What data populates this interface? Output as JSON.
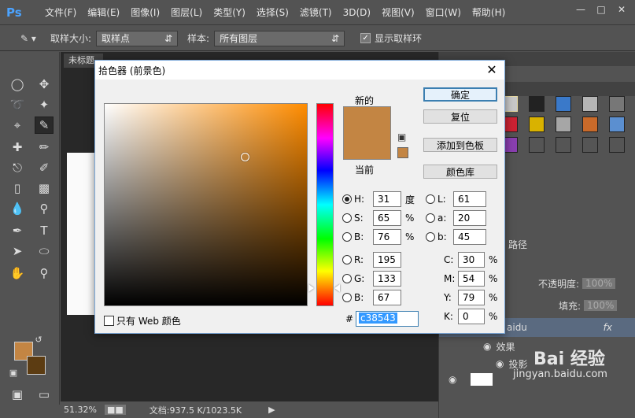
{
  "app": {
    "logo": "Ps",
    "menu": [
      "文件(F)",
      "编辑(E)",
      "图像(I)",
      "图层(L)",
      "类型(Y)",
      "选择(S)",
      "滤镜(T)",
      "3D(D)",
      "视图(V)",
      "窗口(W)",
      "帮助(H)"
    ]
  },
  "options": {
    "sample_size_label": "取样大小:",
    "sample_size_value": "取样点",
    "sample_label": "样本:",
    "sample_value": "所有图层",
    "show_ring_label": "显示取样环"
  },
  "document": {
    "tab_label": "未标题",
    "zoom": "51.32%",
    "doc_info": "文档:937.5 K/1023.5K"
  },
  "layers_panel": {
    "paths_tab": "路径",
    "opacity_label": "不透明度:",
    "opacity_value": "100%",
    "fill_label": "填充:",
    "fill_value": "100%",
    "layer_name": "aidu",
    "fx_label": "fx",
    "effects_label": "效果",
    "shadow_label": "投影"
  },
  "dialog": {
    "title": "拾色器 (前景色)",
    "new_label": "新的",
    "current_label": "当前",
    "buttons": {
      "ok": "确定",
      "reset": "复位",
      "add_swatch": "添加到色板",
      "color_library": "颜色库"
    },
    "web_only_label": "只有 Web 颜色",
    "hsb": [
      {
        "label": "H:",
        "value": "31",
        "unit": "度",
        "selected": true
      },
      {
        "label": "S:",
        "value": "65",
        "unit": "%",
        "selected": false
      },
      {
        "label": "B:",
        "value": "76",
        "unit": "%",
        "selected": false
      }
    ],
    "rgb": [
      {
        "label": "R:",
        "value": "195"
      },
      {
        "label": "G:",
        "value": "133"
      },
      {
        "label": "B:",
        "value": "67"
      }
    ],
    "lab": [
      {
        "label": "L:",
        "value": "61"
      },
      {
        "label": "a:",
        "value": "20"
      },
      {
        "label": "b:",
        "value": "45"
      }
    ],
    "cmyk": [
      {
        "label": "C:",
        "value": "30",
        "unit": "%"
      },
      {
        "label": "M:",
        "value": "54",
        "unit": "%"
      },
      {
        "label": "Y:",
        "value": "79",
        "unit": "%"
      },
      {
        "label": "K:",
        "value": "0",
        "unit": "%"
      }
    ],
    "hex_prefix": "#",
    "hex_value": "c38543"
  },
  "colors": {
    "foreground": "#c38543",
    "background": "#5c3c12"
  },
  "watermark": {
    "text": "Bai 经验",
    "url": "jingyan.baidu.com"
  }
}
